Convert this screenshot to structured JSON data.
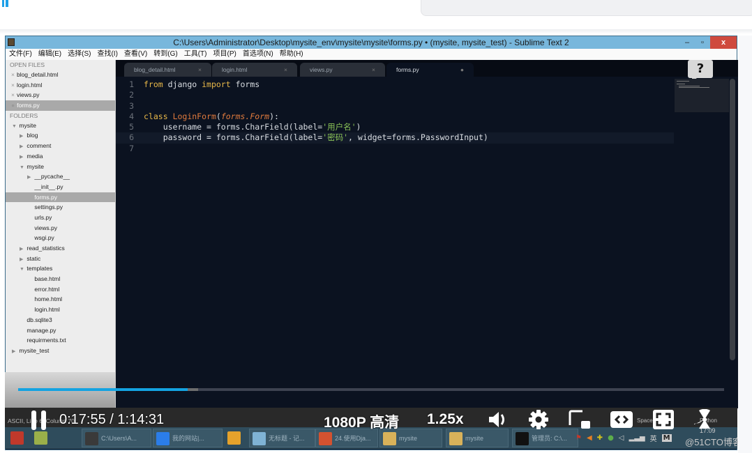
{
  "window": {
    "title": "C:\\Users\\Administrator\\Desktop\\mysite_env\\mysite\\mysite\\forms.py • (mysite, mysite_test) - Sublime Text 2",
    "minimize": "–",
    "restore": "▫",
    "close": "x"
  },
  "menu": [
    "文件(F)",
    "编辑(E)",
    "选择(S)",
    "查找(I)",
    "查看(V)",
    "转到(G)",
    "工具(T)",
    "项目(P)",
    "首选项(N)",
    "帮助(H)"
  ],
  "sidebar": {
    "open_files_label": "OPEN FILES",
    "open_files": [
      {
        "name": "blog_detail.html",
        "marker": "×"
      },
      {
        "name": "login.html",
        "marker": "×"
      },
      {
        "name": "views.py",
        "marker": "×"
      },
      {
        "name": "forms.py",
        "marker": "●",
        "selected": true
      }
    ],
    "folders_label": "FOLDERS",
    "tree": [
      {
        "name": "mysite",
        "depth": 0,
        "type": "folder-open"
      },
      {
        "name": "blog",
        "depth": 1,
        "type": "folder"
      },
      {
        "name": "comment",
        "depth": 1,
        "type": "folder"
      },
      {
        "name": "media",
        "depth": 1,
        "type": "folder"
      },
      {
        "name": "mysite",
        "depth": 1,
        "type": "folder-open"
      },
      {
        "name": "__pycache__",
        "depth": 2,
        "type": "folder"
      },
      {
        "name": "__init__.py",
        "depth": 2,
        "type": "file"
      },
      {
        "name": "forms.py",
        "depth": 2,
        "type": "file",
        "selected": true
      },
      {
        "name": "settings.py",
        "depth": 2,
        "type": "file"
      },
      {
        "name": "urls.py",
        "depth": 2,
        "type": "file"
      },
      {
        "name": "views.py",
        "depth": 2,
        "type": "file"
      },
      {
        "name": "wsgi.py",
        "depth": 2,
        "type": "file"
      },
      {
        "name": "read_statistics",
        "depth": 1,
        "type": "folder"
      },
      {
        "name": "static",
        "depth": 1,
        "type": "folder"
      },
      {
        "name": "templates",
        "depth": 1,
        "type": "folder-open"
      },
      {
        "name": "base.html",
        "depth": 2,
        "type": "file"
      },
      {
        "name": "error.html",
        "depth": 2,
        "type": "file"
      },
      {
        "name": "home.html",
        "depth": 2,
        "type": "file"
      },
      {
        "name": "login.html",
        "depth": 2,
        "type": "file"
      },
      {
        "name": "db.sqlite3",
        "depth": 1,
        "type": "file"
      },
      {
        "name": "manage.py",
        "depth": 1,
        "type": "file"
      },
      {
        "name": "requirments.txt",
        "depth": 1,
        "type": "file"
      },
      {
        "name": "mysite_test",
        "depth": 0,
        "type": "folder"
      }
    ]
  },
  "tabs": [
    {
      "label": "blog_detail.html",
      "close": "×"
    },
    {
      "label": "login.html",
      "close": "×"
    },
    {
      "label": "views.py",
      "close": "×"
    },
    {
      "label": "forms.py",
      "close": "●",
      "active": true
    }
  ],
  "code": {
    "line_numbers": [
      "1",
      "2",
      "3",
      "4",
      "5",
      "6",
      "7"
    ],
    "l1": {
      "kw1": "from",
      "t1": " django ",
      "kw2": "import",
      "t2": " forms"
    },
    "l4": {
      "kw": "class",
      "name": "LoginForm",
      "p1": "(",
      "base": "forms.Form",
      "p2": "):"
    },
    "l5": {
      "indent": "    ",
      "a": "username = forms.CharField(label=",
      "s": "'用户名'",
      "b": ")"
    },
    "l6": {
      "indent": "    ",
      "a": "password = forms.CharField(label=",
      "s": "'密码'",
      "b": ", widget=forms.PasswordInput)"
    }
  },
  "help_label": "?",
  "status": {
    "left": "ASCII, Line 6, Column 70",
    "spaces": "Spaces: 4",
    "syntax": "Python"
  },
  "player": {
    "current_time": "0:17:55",
    "separator": "/",
    "total_time": "1:14:31",
    "progress_fraction": 0.24,
    "buffered_fraction": 0.255,
    "quality": "1080P 高清",
    "speed": "1.25x"
  },
  "taskbar": {
    "items": [
      {
        "label": "",
        "color": "#c0392b"
      },
      {
        "label": "",
        "color": "#9ab04a"
      },
      {
        "label": "C:\\Users\\A...",
        "color": "#3a3a3a"
      },
      {
        "label": "我的网站|...",
        "color": "#2b7de9"
      },
      {
        "label": "",
        "color": "#e5a22b"
      },
      {
        "label": "无标题 - 记...",
        "color": "#7fb3d5"
      },
      {
        "label": "24.使用Dja...",
        "color": "#d35230"
      },
      {
        "label": "mysite",
        "color": "#d9b25a"
      },
      {
        "label": "mysite",
        "color": "#d9b25a"
      },
      {
        "label": "管理员: C:\\...",
        "color": "#111111"
      }
    ],
    "ime": "英",
    "clock": "17:09"
  },
  "watermark": "@51CTO博客"
}
